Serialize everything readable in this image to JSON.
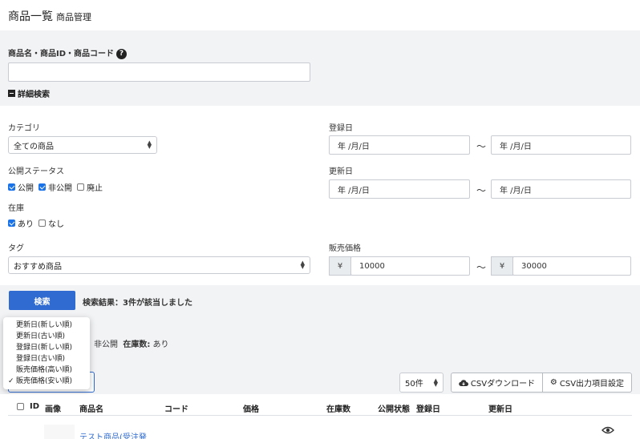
{
  "header": {
    "title": "商品一覧",
    "subtitle": "商品管理"
  },
  "search": {
    "keyword_label": "商品名・商品ID・商品コード",
    "keyword_value": "",
    "help": "?",
    "detail_toggle": "詳細検索"
  },
  "filters": {
    "category_label": "カテゴリ",
    "category_value": "全ての商品",
    "status_label": "公開ステータス",
    "status_options": [
      {
        "label": "公開",
        "checked": true
      },
      {
        "label": "非公開",
        "checked": true
      },
      {
        "label": "廃止",
        "checked": false
      }
    ],
    "stock_label": "在庫",
    "stock_options": [
      {
        "label": "あり",
        "checked": true
      },
      {
        "label": "なし",
        "checked": false
      }
    ],
    "tag_label": "タグ",
    "tag_value": "おすすめ商品",
    "created_label": "登録日",
    "created_from": "年 /月/日",
    "created_to": "年 /月/日",
    "updated_label": "更新日",
    "updated_from": "年 /月/日",
    "updated_to": "年 /月/日",
    "price_label": "販売価格",
    "price_from": "10000",
    "price_to": "30000",
    "currency": "¥",
    "tilde": "～"
  },
  "actions": {
    "search_button": "検索",
    "result_text": "検索結果：3件が該当しました"
  },
  "applied": {
    "status": "非公開",
    "stock_label": "在庫数:",
    "stock_value": "あり"
  },
  "sort_menu": {
    "items": [
      "更新日(新しい順)",
      "更新日(古い順)",
      "登録日(新しい順)",
      "登録日(古い順)",
      "販売価格(高い順)",
      "販売価格(安い順)"
    ],
    "selected_index": 5,
    "check": "✓"
  },
  "toolbar": {
    "per_page": "50件",
    "csv_download": "CSVダウンロード",
    "csv_settings": "CSV出力項目設定"
  },
  "table": {
    "headers": [
      "ID",
      "画像",
      "商品名",
      "コード",
      "価格",
      "在庫数",
      "公開状態",
      "登録日",
      "更新日"
    ],
    "row_name": "テスト商品(受注発"
  }
}
